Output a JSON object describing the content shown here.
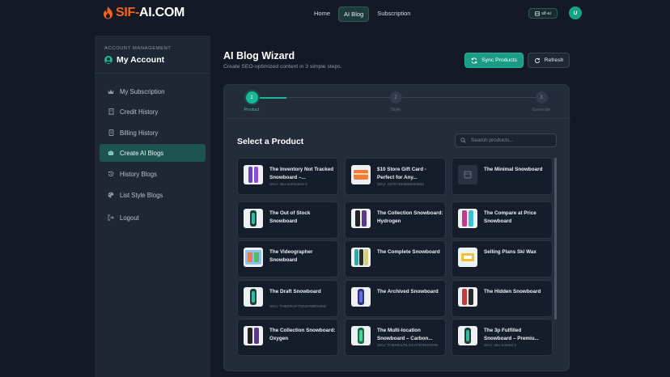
{
  "brand": {
    "name_accent": "SIF-",
    "name_rest": "AI.COM",
    "accent_color": "#f2641d"
  },
  "nav": {
    "links": [
      "Home",
      "AI Blog",
      "Subscription"
    ],
    "active": "AI Blog"
  },
  "lang_badge": "sif-ai",
  "user_initial": "U",
  "sidebar": {
    "section_label": "ACCOUNT MANAGEMENT",
    "account_title": "My Account",
    "items": [
      {
        "label": "My Subscription",
        "icon": "crown-icon"
      },
      {
        "label": "Credit History",
        "icon": "receipt-icon"
      },
      {
        "label": "Billing History",
        "icon": "document-icon"
      },
      {
        "label": "Create AI Blogs",
        "icon": "robot-icon",
        "active": true
      },
      {
        "label": "History Blogs",
        "icon": "history-icon"
      },
      {
        "label": "List Style Blogs",
        "icon": "palette-icon"
      },
      {
        "label": "Logout",
        "icon": "logout-icon"
      }
    ]
  },
  "main": {
    "title": "AI Blog Wizard",
    "subtitle": "Create SEO-optimized content in 3 simple steps.",
    "sync_label": "Sync Products",
    "refresh_label": "Refresh"
  },
  "wizard": {
    "steps": [
      {
        "num": "1",
        "label": "Product",
        "active": true
      },
      {
        "num": "2",
        "label": "Style"
      },
      {
        "num": "3",
        "label": "Generate"
      }
    ],
    "select_title": "Select a Product",
    "search_placeholder": "Search products..."
  },
  "products": [
    {
      "title": "The Inventory Not Tracked Snowboard –...",
      "sku": "SKU: sku-untracked-1",
      "thumb": "purple-board"
    },
    {
      "title": "$10 Store Gift Card - Perfect for Any...",
      "sku": "SKU: 15797464508032632",
      "thumb": "gift-card"
    },
    {
      "title": "The Minimal Snowboard",
      "sku": "",
      "thumb": "none"
    },
    {
      "title": "The Out of Stock Snowboard",
      "sku": "",
      "thumb": "teal-board"
    },
    {
      "title": "The Collection Snowboard: Hydrogen",
      "sku": "",
      "thumb": "black-board"
    },
    {
      "title": "The Compare at Price Snowboard",
      "sku": "",
      "thumb": "pink-board"
    },
    {
      "title": "The Videographer Snowboard",
      "sku": "",
      "thumb": "colorful-board"
    },
    {
      "title": "The Complete Snowboard",
      "sku": "",
      "thumb": "mixed-board"
    },
    {
      "title": "Selling Plans Ski Wax",
      "sku": "",
      "thumb": "wax"
    },
    {
      "title": "The Draft Snowboard",
      "sku": "SKU: THEDRAFTSNOWBOARD",
      "thumb": "teal-board"
    },
    {
      "title": "The Archived Snowboard",
      "sku": "",
      "thumb": "navy-board"
    },
    {
      "title": "The Hidden Snowboard",
      "sku": "",
      "thumb": "red-board"
    },
    {
      "title": "The Collection Snowboard: Oxygen",
      "sku": "",
      "thumb": "black-board"
    },
    {
      "title": "The Multi-location Snowboard – Carbon...",
      "sku": "SKU: THEMULTILOCATIONSNOW",
      "thumb": "green-board"
    },
    {
      "title": "The 3p Fulfilled Snowboard – Premiu...",
      "sku": "SKU: sku-hosted-1",
      "thumb": "teal-board"
    }
  ]
}
